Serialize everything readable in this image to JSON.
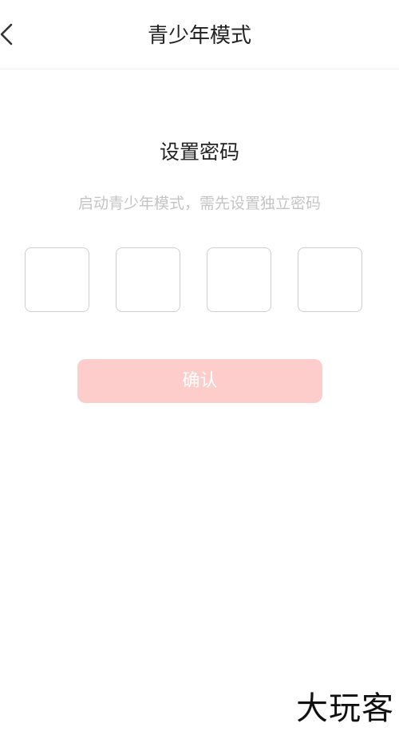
{
  "header": {
    "back_icon": "chevron-left-icon",
    "title": "青少年模式"
  },
  "main": {
    "title": "设置密码",
    "subtitle": "启动青少年模式，需先设置独立密码",
    "pin_boxes": [
      "",
      "",
      "",
      ""
    ],
    "confirm_label": "确认"
  },
  "watermark": {
    "text": "大玩客"
  },
  "colors": {
    "confirm_button_disabled": "#fdcdcb",
    "subtitle_text": "#c4c4c4",
    "pin_border": "#cfcfcf"
  }
}
